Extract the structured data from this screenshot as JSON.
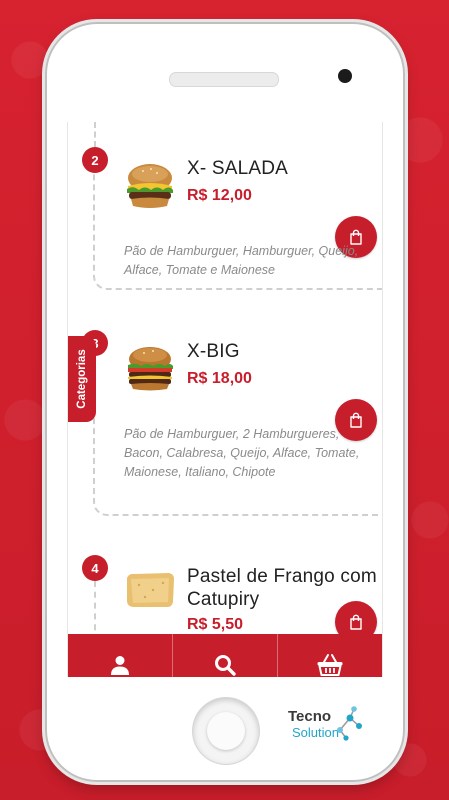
{
  "menu": {
    "items": [
      {
        "number": "2",
        "name": "X- SALADA",
        "price": "R$ 12,00",
        "description": "Pão de Hamburguer, Hamburguer, Queijo, Alface, Tomate e Maionese"
      },
      {
        "number": "3",
        "name": "X-BIG",
        "price": "R$ 18,00",
        "description": "Pão de Hamburguer, 2 Hamburgueres, Bacon, Calabresa, Queijo, Alface, Tomate, Maionese, Italiano, Chipote"
      },
      {
        "number": "4",
        "name": "Pastel de Frango com Catupiry",
        "price": "R$ 5,50"
      }
    ]
  },
  "categories_tab": {
    "label": "Categorias"
  },
  "bottom_nav": {
    "items": [
      {
        "icon": "user-icon"
      },
      {
        "icon": "search-icon"
      },
      {
        "icon": "basket-icon"
      }
    ]
  },
  "brand": {
    "line1": "Tecno",
    "line2": "Solution"
  },
  "colors": {
    "accent": "#c71e2c",
    "background": "#d0202e",
    "brand_blue": "#23a5c9"
  }
}
